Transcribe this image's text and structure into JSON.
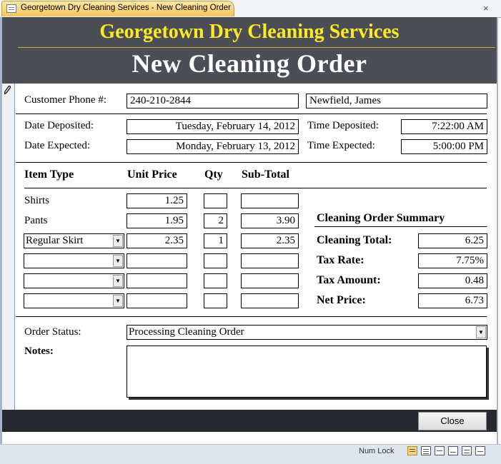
{
  "tab": {
    "title": "Georgetown Dry Cleaning Services - New Cleaning Order",
    "close_glyph": "×"
  },
  "header": {
    "company": "Georgetown Dry Cleaning Services",
    "form_title": "New Cleaning Order"
  },
  "customer": {
    "phone_label": "Customer Phone #:",
    "phone": "240-210-2844",
    "name": "Newfield, James"
  },
  "dates": {
    "deposited_label": "Date Deposited:",
    "deposited": "Tuesday, February 14, 2012",
    "expected_label": "Date Expected:",
    "expected": "Monday, February 13, 2012",
    "time_deposited_label": "Time Deposited:",
    "time_deposited": "7:22:00 AM",
    "time_expected_label": "Time Expected:",
    "time_expected": "5:00:00 PM"
  },
  "items": {
    "headers": {
      "type": "Item Type",
      "unit_price": "Unit Price",
      "qty": "Qty",
      "subtotal": "Sub-Total"
    },
    "shirts": {
      "label": "Shirts",
      "unit_price": "1.25",
      "qty": "",
      "subtotal": ""
    },
    "pants": {
      "label": "Pants",
      "unit_price": "1.95",
      "qty": "2",
      "subtotal": "3.90"
    },
    "other": [
      {
        "type": "Regular Skirt",
        "unit_price": "2.35",
        "qty": "1",
        "subtotal": "2.35"
      },
      {
        "type": "",
        "unit_price": "",
        "qty": "",
        "subtotal": ""
      },
      {
        "type": "",
        "unit_price": "",
        "qty": "",
        "subtotal": ""
      },
      {
        "type": "",
        "unit_price": "",
        "qty": "",
        "subtotal": ""
      }
    ]
  },
  "summary": {
    "title": "Cleaning Order Summary",
    "cleaning_total_label": "Cleaning Total:",
    "cleaning_total": "6.25",
    "tax_rate_label": "Tax Rate:",
    "tax_rate": "7.75%",
    "tax_amount_label": "Tax Amount:",
    "tax_amount": "0.48",
    "net_price_label": "Net Price:",
    "net_price": "6.73"
  },
  "status": {
    "label": "Order Status:",
    "value": "Processing Cleaning Order",
    "notes_label": "Notes:",
    "notes": ""
  },
  "footer": {
    "close_label": "Close"
  },
  "statusbar": {
    "num_lock": "Num Lock"
  },
  "colors": {
    "header_bg": "#4b4f55",
    "company_title": "#ffea21",
    "footer_bg": "#26292d"
  }
}
